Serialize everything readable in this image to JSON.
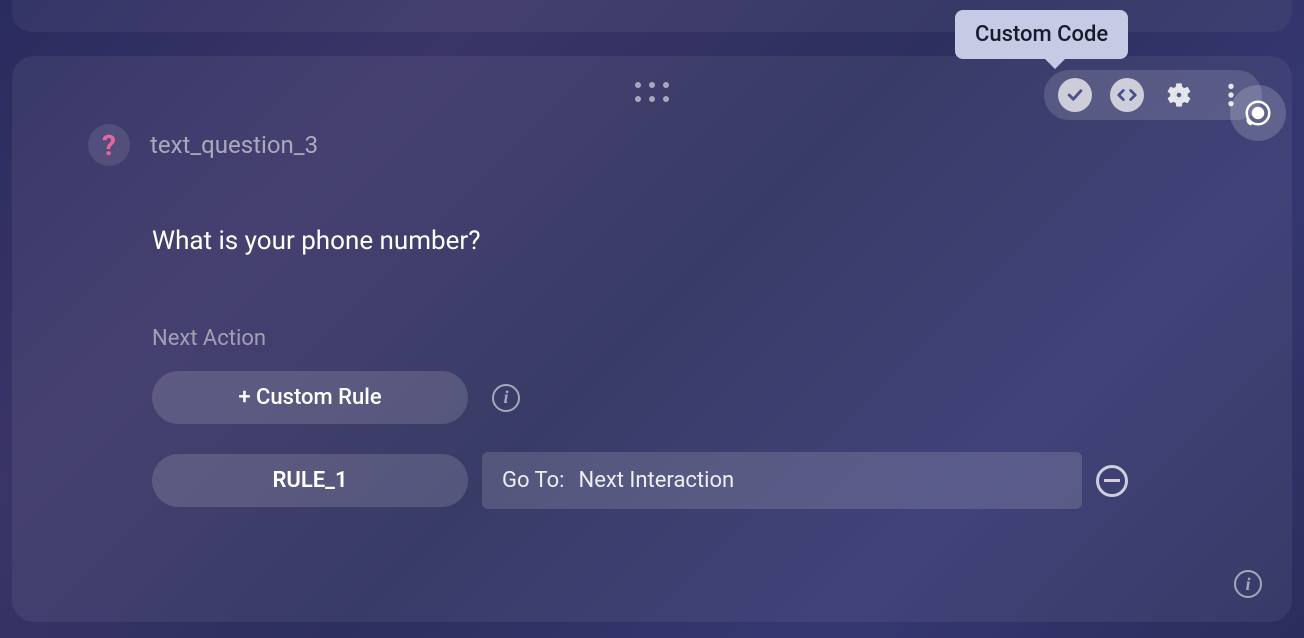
{
  "tooltip": {
    "label": "Custom Code"
  },
  "card": {
    "header": {
      "icon_glyph": "?",
      "title": "text_question_3"
    },
    "question": "What is your phone number?",
    "nextActionLabel": "Next Action",
    "customRuleButton": "+ Custom Rule",
    "rule": {
      "name": "RULE_1",
      "gotoLabel": "Go To:",
      "gotoValue": "Next Interaction"
    }
  }
}
